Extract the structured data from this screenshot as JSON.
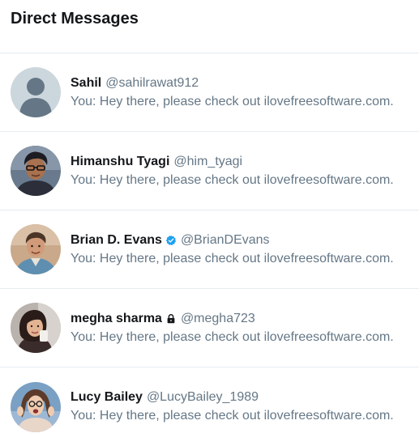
{
  "header": {
    "title": "Direct Messages"
  },
  "conversations": [
    {
      "name": "Sahil",
      "handle": "@sahilrawat912",
      "preview": "You: Hey there, please check out ilovefreesoftware.com.",
      "avatar": "default-avatar-icon"
    },
    {
      "name": "Himanshu Tyagi",
      "handle": "@him_tyagi",
      "preview": "You: Hey there, please check out ilovefreesoftware.com.",
      "avatar": "profile-photo"
    },
    {
      "name": "Brian D. Evans",
      "handle": "@BrianDEvans",
      "preview": "You: Hey there, please check out ilovefreesoftware.com.",
      "avatar": "profile-photo",
      "badge": "verified-badge-icon"
    },
    {
      "name": "megha sharma",
      "handle": "@megha723",
      "preview": "You: Hey there, please check out ilovefreesoftware.com.",
      "avatar": "profile-photo",
      "badge": "lock-icon"
    },
    {
      "name": "Lucy Bailey",
      "handle": "@LucyBailey_1989",
      "preview": "You: Hey there, please check out ilovefreesoftware.com.",
      "avatar": "profile-photo"
    }
  ],
  "colors": {
    "name_text": "#14171a",
    "muted_text": "#657786",
    "divider": "#e6ecf0",
    "verified_blue": "#1da1f2"
  }
}
